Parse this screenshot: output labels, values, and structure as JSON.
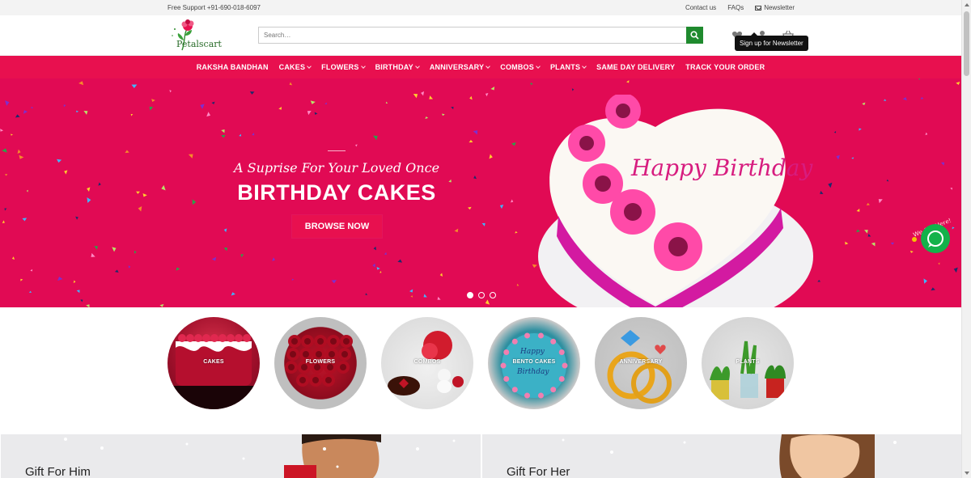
{
  "topbar": {
    "support": "Free Support +91-690-018-6097",
    "contact": "Contact us",
    "faqs": "FAQs",
    "newsletter": "Newsletter"
  },
  "header": {
    "logo_text": "Petalscart",
    "search_placeholder": "Search…",
    "tooltip": "Sign up for Newsletter"
  },
  "nav": {
    "items": [
      {
        "label": "RAKSHA BANDHAN",
        "dropdown": false
      },
      {
        "label": "CAKES",
        "dropdown": true
      },
      {
        "label": "FLOWERS",
        "dropdown": true
      },
      {
        "label": "BIRTHDAY",
        "dropdown": true
      },
      {
        "label": "ANNIVERSARY",
        "dropdown": true
      },
      {
        "label": "COMBOS",
        "dropdown": true
      },
      {
        "label": "PLANTS",
        "dropdown": true
      },
      {
        "label": "SAME DAY DELIVERY",
        "dropdown": false
      },
      {
        "label": "TRACK YOUR ORDER",
        "dropdown": false
      }
    ]
  },
  "hero": {
    "subtitle": "A Suprise For Your Loved Once",
    "title": "BIRTHDAY CAKES",
    "button": "BROWSE NOW",
    "cake_text": "Happy Birthday",
    "slides": 3,
    "active_slide": 1
  },
  "chat": {
    "label": "We Are Here!"
  },
  "categories": [
    {
      "label": "CAKES"
    },
    {
      "label": "FLOWERS"
    },
    {
      "label": "COMBOS"
    },
    {
      "label": "BENTO CAKES"
    },
    {
      "label": "ANNIVERSARY"
    },
    {
      "label": "PLANTS"
    }
  ],
  "promos": [
    {
      "title": "Gift For Him"
    },
    {
      "title": "Gift For Her"
    }
  ],
  "colors": {
    "brand": "#e8104f",
    "hero_bg": "#e10a54",
    "search_button": "#1f8a2e",
    "chat_green": "#13b24a"
  }
}
